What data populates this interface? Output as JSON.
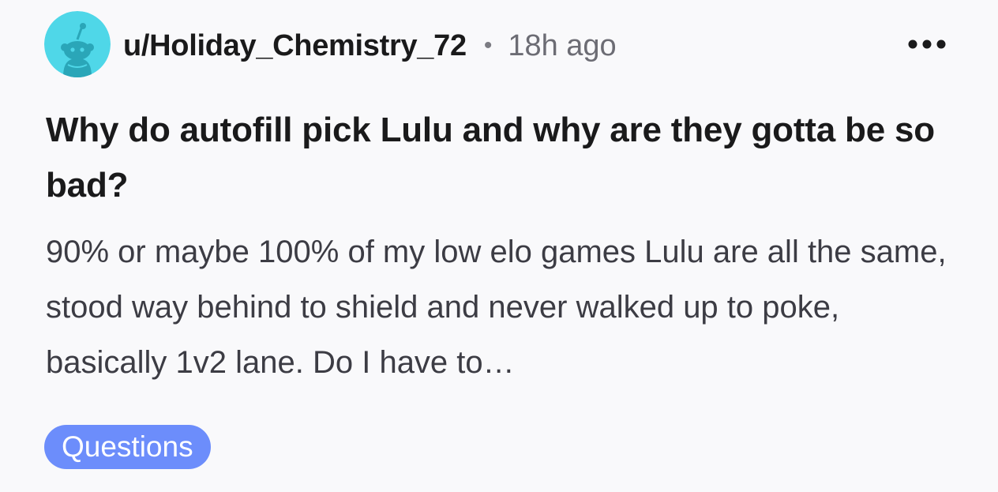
{
  "post": {
    "author": "u/Holiday_Chemistry_72",
    "separator": "•",
    "timestamp": "18h ago",
    "title": "Why do autofill pick Lulu and why are they gotta be so bad?",
    "body": "90% or maybe 100% of my low elo games Lulu are all the same, stood way behind to shield and never walked up to poke, basically 1v2 lane. Do I have to…",
    "flair": "Questions",
    "avatar_icon": "reddit-snoo-avatar-icon",
    "more_icon": "more-options-icon"
  },
  "colors": {
    "background": "#f9f9fb",
    "avatar_background": "#4fd7e8",
    "flair_background": "#6c8dfb",
    "title_text": "#1a1a1b",
    "body_text": "#3c3c44",
    "meta_text": "#6c6c74"
  }
}
